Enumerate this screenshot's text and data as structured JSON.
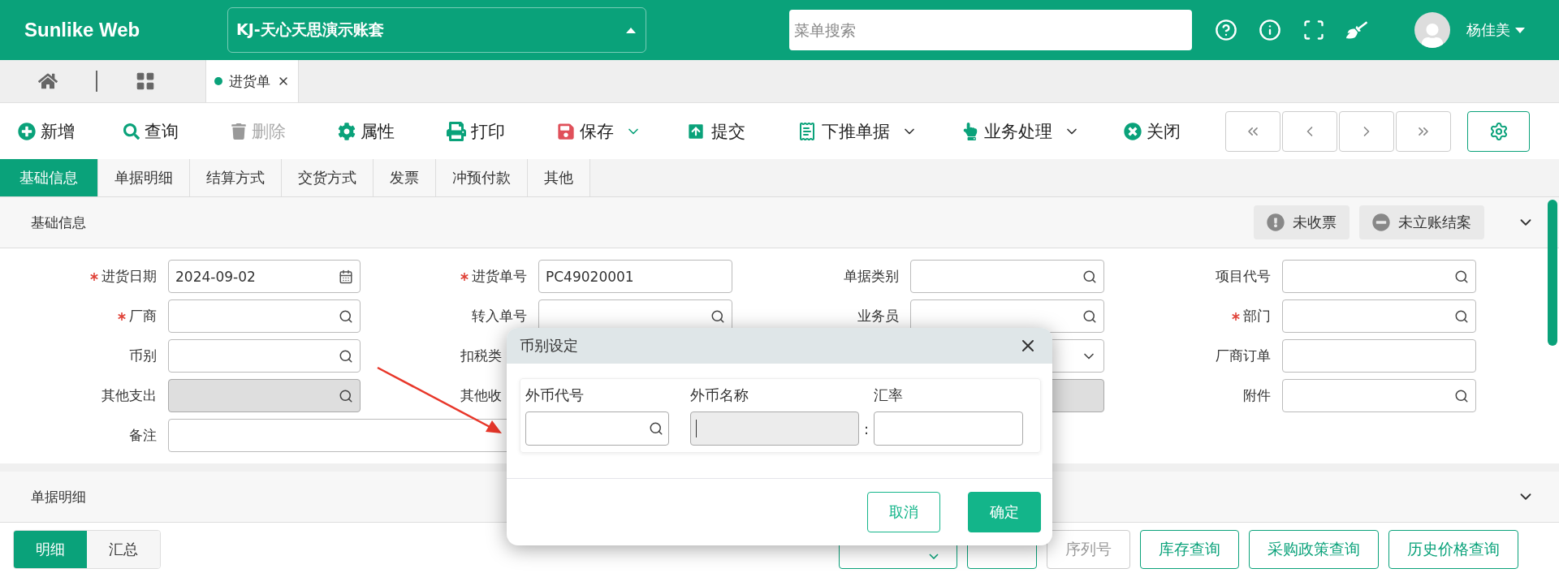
{
  "header": {
    "title": "Sunlike Web",
    "account": "KJ-天心天思演示账套",
    "search": {
      "placeholder": "菜单搜索"
    },
    "user": "杨佳美"
  },
  "page_tabs": [
    {
      "label": "进货单",
      "selected": true
    }
  ],
  "toolbar": [
    {
      "label": "新增",
      "disabled": false,
      "dropdown": false
    },
    {
      "label": "查询",
      "disabled": false,
      "dropdown": false
    },
    {
      "label": "删除",
      "disabled": true,
      "dropdown": false
    },
    {
      "label": "属性",
      "disabled": false,
      "dropdown": false
    },
    {
      "label": "打印",
      "disabled": false,
      "dropdown": false
    },
    {
      "label": "保存",
      "disabled": false,
      "dropdown": true
    },
    {
      "label": "提交",
      "disabled": false,
      "dropdown": false
    },
    {
      "label": "下推单据",
      "disabled": false,
      "dropdown": true
    },
    {
      "label": "业务处理",
      "disabled": false,
      "dropdown": true
    },
    {
      "label": "关闭",
      "disabled": false,
      "dropdown": false
    }
  ],
  "form_tabs": [
    {
      "label": "基础信息",
      "selected": true
    },
    {
      "label": "单据明细",
      "selected": false
    },
    {
      "label": "结算方式",
      "selected": false
    },
    {
      "label": "交货方式",
      "selected": false
    },
    {
      "label": "发票",
      "selected": false
    },
    {
      "label": "冲预付款",
      "selected": false
    },
    {
      "label": "其他",
      "selected": false
    }
  ],
  "basic_section": {
    "title": "基础信息",
    "badges": [
      "未收票",
      "未立账结案"
    ],
    "expanded": true
  },
  "fields": [
    {
      "label": "进货日期",
      "required": true,
      "kind": "date",
      "value": "2024-09-02",
      "disabled": false
    },
    {
      "label": "进货单号",
      "required": true,
      "kind": "text",
      "value": "PC49020001",
      "disabled": false
    },
    {
      "label": "单据类别",
      "required": false,
      "kind": "search",
      "disabled": false
    },
    {
      "label": "项目代号",
      "required": false,
      "kind": "search",
      "disabled": false
    },
    {
      "label": "厂商",
      "required": true,
      "kind": "search",
      "disabled": false
    },
    {
      "label": "转入单号",
      "required": false,
      "kind": "search",
      "disabled": false
    },
    {
      "label": "业务员",
      "required": false,
      "kind": "search",
      "disabled": false
    },
    {
      "label": "部门",
      "required": true,
      "kind": "search",
      "disabled": false
    },
    {
      "label": "币别",
      "required": false,
      "kind": "search",
      "disabled": false
    },
    {
      "label": "扣税类",
      "kind": "hidden"
    },
    {
      "kind": "select",
      "disabled": false
    },
    {
      "label": "厂商订单",
      "required": false,
      "kind": "text",
      "disabled": false
    },
    {
      "label": "其他支出",
      "required": false,
      "kind": "search",
      "disabled": true
    },
    {
      "label": "其他收",
      "kind": "hidden"
    },
    {
      "kind": "text",
      "disabled": true
    },
    {
      "label": "附件",
      "required": false,
      "kind": "search",
      "disabled": false
    },
    {
      "label": "备注",
      "required": false,
      "kind": "wide",
      "disabled": false
    }
  ],
  "detail_section": {
    "title": "单据明细",
    "expanded": true
  },
  "detail_tabs": [
    {
      "label": "明细",
      "selected": true
    },
    {
      "label": "汇总",
      "selected": false
    }
  ],
  "detail_buttons": [
    {
      "disabled": false,
      "dropdown": true
    },
    {
      "disabled": false,
      "dropdown": false
    },
    {
      "label": "序列号",
      "disabled": true,
      "dropdown": false
    },
    {
      "label": "库存查询",
      "disabled": false,
      "dropdown": false
    },
    {
      "label": "采购政策查询",
      "disabled": false,
      "dropdown": false
    },
    {
      "label": "历史价格查询",
      "disabled": false,
      "dropdown": false
    }
  ],
  "dialog": {
    "title": "币别设定",
    "columns": [
      "外币代号",
      "外币名称",
      "汇率"
    ],
    "separator": ":",
    "buttons": [
      {
        "label": "取消",
        "primary": false
      },
      {
        "label": "确定",
        "primary": true
      }
    ]
  }
}
